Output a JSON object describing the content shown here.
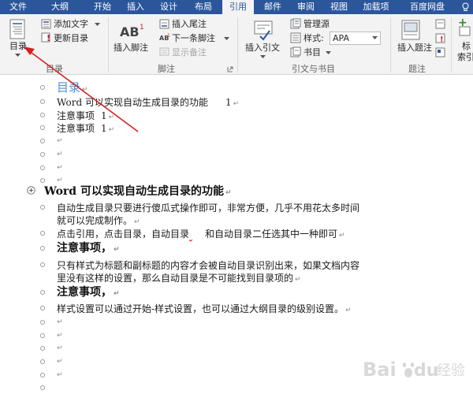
{
  "tabs": [
    "文件",
    "大纲",
    "开始",
    "插入",
    "设计",
    "布局",
    "引用",
    "邮件",
    "审阅",
    "视图",
    "加载项",
    "百度网盘"
  ],
  "active_tab_index": 6,
  "ribbon": {
    "toc": {
      "toc_button": "目录",
      "add_text": "添加文字",
      "update_toc": "更新目录",
      "group": "目录"
    },
    "footnotes": {
      "insert_footnote": "插入脚注",
      "insert_endnote": "插入尾注",
      "next_footnote": "下一条脚注",
      "show_notes": "显示备注",
      "group": "脚注"
    },
    "citations": {
      "insert_citation": "插入引文",
      "manage_sources": "管理源",
      "style_label": "样式:",
      "style_value": "APA",
      "bibliography": "书目",
      "group": "引文与书目"
    },
    "captions": {
      "insert_caption": "插入题注",
      "group": "题注"
    },
    "index": {
      "mark_entry_line1": "标",
      "mark_entry_line2": "索引"
    }
  },
  "doc": {
    "toc_title": "目录",
    "toc_entries": [
      {
        "text": "Word 可以实现自动生成目录的功能",
        "page": "1"
      },
      {
        "text": "注意事项",
        "page": "1"
      },
      {
        "text": "注意事项",
        "page": "1"
      }
    ],
    "heading": "Word 可以实现自动生成目录的功能",
    "para1_line1": "自动生成目录只要进行傻瓜式操作即可，非常方便，几乎不用花太多时间",
    "para1_line2": "就可以完成制作。",
    "para2_a": "点击引用，点击目录，自动目录",
    "para2_b": "和自动目录二任选其中一种即可",
    "sub1": "注意事项，",
    "para3_line1": "只有样式为标题和副标题的内容才会被自动目录识别出来，如果文档内容",
    "para3_line2": "里没有这样的设置，那么自动目录是不可能找到目录项的",
    "sub2": "注意事项，",
    "para4": "样式设置可以通过开始-样式设置，也可以通过大纲目录的级别设置。",
    "para_mark": "↵"
  },
  "watermark": {
    "brand": "Bai",
    "du": "du",
    "text": "经验"
  },
  "colors": {
    "tab_bar": "#2b579a",
    "toc_title": "#4d8fd1",
    "arrow": "#d62020"
  }
}
